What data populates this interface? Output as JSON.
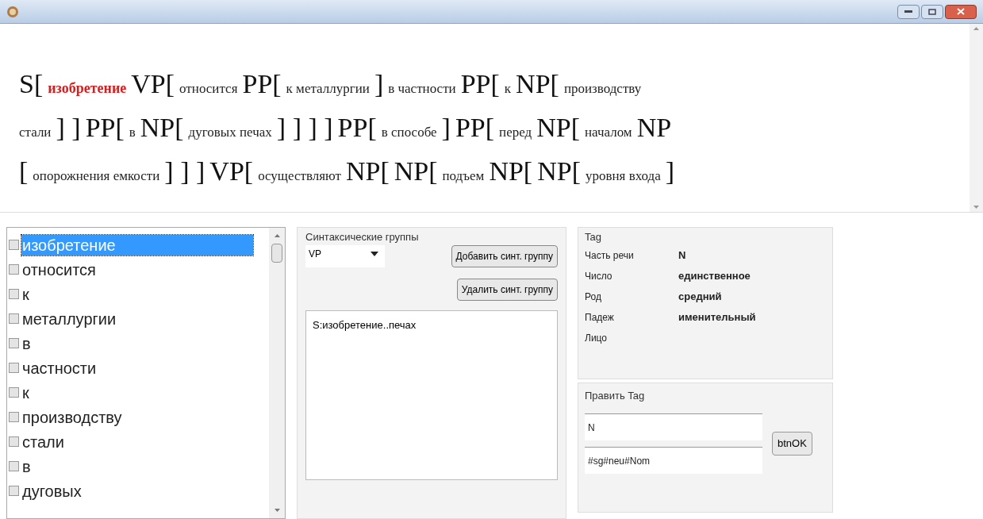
{
  "parse_view": {
    "lines": [
      [
        {
          "kind": "label",
          "text": "S["
        },
        {
          "kind": "word",
          "text": "изобретение",
          "highlighted": true
        },
        {
          "kind": "label",
          "text": "VP["
        },
        {
          "kind": "word",
          "text": "относится",
          "highlighted": false
        },
        {
          "kind": "label",
          "text": "PP["
        },
        {
          "kind": "word",
          "text": "к металлургии",
          "highlighted": false
        },
        {
          "kind": "label",
          "text": "]"
        },
        {
          "kind": "word",
          "text": "в частности",
          "highlighted": false
        },
        {
          "kind": "label",
          "text": "PP["
        },
        {
          "kind": "word",
          "text": "к",
          "highlighted": false
        },
        {
          "kind": "label",
          "text": "NP["
        },
        {
          "kind": "word",
          "text": "производству",
          "highlighted": false
        }
      ],
      [
        {
          "kind": "word",
          "text": "стали",
          "highlighted": false
        },
        {
          "kind": "label",
          "text": "] ]"
        },
        {
          "kind": "label",
          "text": "PP["
        },
        {
          "kind": "word",
          "text": "в",
          "highlighted": false
        },
        {
          "kind": "label",
          "text": "NP["
        },
        {
          "kind": "word",
          "text": "дуговых печах",
          "highlighted": false
        },
        {
          "kind": "label",
          "text": "] ] ] ]"
        },
        {
          "kind": "label",
          "text": "PP["
        },
        {
          "kind": "word",
          "text": "в способе",
          "highlighted": false
        },
        {
          "kind": "label",
          "text": "]"
        },
        {
          "kind": "label",
          "text": "PP["
        },
        {
          "kind": "word",
          "text": "перед",
          "highlighted": false
        },
        {
          "kind": "label",
          "text": "NP["
        },
        {
          "kind": "word",
          "text": "началом",
          "highlighted": false
        },
        {
          "kind": "label",
          "text": "NP"
        }
      ],
      [
        {
          "kind": "label",
          "text": "["
        },
        {
          "kind": "word",
          "text": "опорожнения емкости",
          "highlighted": false
        },
        {
          "kind": "label",
          "text": "] ] ]"
        },
        {
          "kind": "label",
          "text": "VP["
        },
        {
          "kind": "word",
          "text": "осуществляют",
          "highlighted": false
        },
        {
          "kind": "label",
          "text": "NP["
        },
        {
          "kind": "label",
          "text": "NP["
        },
        {
          "kind": "word",
          "text": "подъем",
          "highlighted": false
        },
        {
          "kind": "label",
          "text": "NP["
        },
        {
          "kind": "label",
          "text": "NP["
        },
        {
          "kind": "word",
          "text": "уровня входа",
          "highlighted": false
        },
        {
          "kind": "label",
          "text": "]"
        }
      ]
    ]
  },
  "word_list": [
    {
      "text": "изобретение",
      "checked": false,
      "selected": true
    },
    {
      "text": "относится",
      "checked": false,
      "selected": false
    },
    {
      "text": "к",
      "checked": false,
      "selected": false
    },
    {
      "text": "металлургии",
      "checked": false,
      "selected": false
    },
    {
      "text": "в",
      "checked": false,
      "selected": false
    },
    {
      "text": "частности",
      "checked": false,
      "selected": false
    },
    {
      "text": "к",
      "checked": false,
      "selected": false
    },
    {
      "text": "производству",
      "checked": false,
      "selected": false
    },
    {
      "text": "стали",
      "checked": false,
      "selected": false
    },
    {
      "text": "в",
      "checked": false,
      "selected": false
    },
    {
      "text": "дуговых",
      "checked": false,
      "selected": false
    }
  ],
  "syntax_groups": {
    "title": "Синтаксические группы",
    "dropdown": "VP",
    "buttons": [
      "Добавить синт. группу",
      "Удалить синт. группу"
    ],
    "groups": [
      "S:изобретение..печах"
    ]
  },
  "tag": {
    "title": "Tag",
    "properties": [
      {
        "label": "Часть речи",
        "value": "N"
      },
      {
        "label": "Число",
        "value": "единственное"
      },
      {
        "label": "Род",
        "value": "средний"
      },
      {
        "label": "Падеж",
        "value": "именительный"
      },
      {
        "label": "Лицо"
      }
    ]
  },
  "edit_tag": {
    "title": "Править Tag",
    "fields": [
      "N",
      "#sg#neu#Nom"
    ],
    "button": "btnOK"
  }
}
